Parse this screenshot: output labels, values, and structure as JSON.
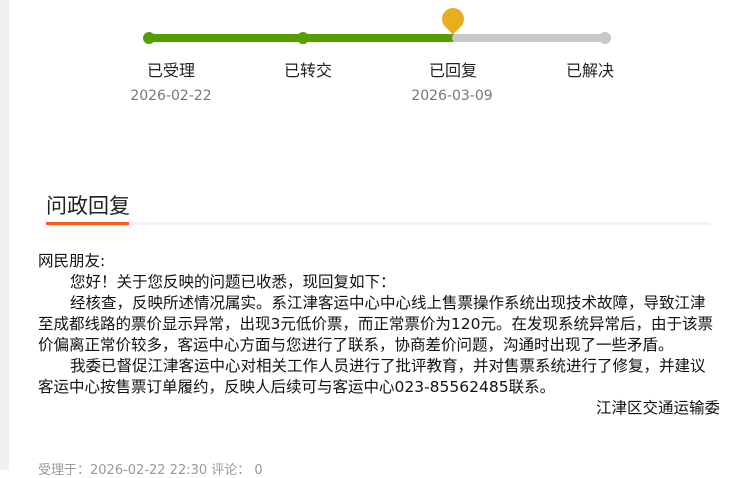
{
  "steps": [
    {
      "label": "已受理",
      "date": "2026-02-22"
    },
    {
      "label": "已转交",
      "date": ""
    },
    {
      "label": "已回复",
      "date": "2026-03-09"
    },
    {
      "label": "已解决",
      "date": ""
    }
  ],
  "colors": {
    "done": "#559e00",
    "pending": "#c8c8c8",
    "current": "#e8ae1c",
    "accent": "#ff5a1f"
  },
  "section_title": "问政回复",
  "reply": {
    "greeting": "网民朋友:",
    "p1": "您好！关于您反映的问题已收悉，现回复如下：",
    "p2": "经核查，反映所述情况属实。系江津客运中心中心线上售票操作系统出现技术故障，导致江津至成都线路的票价显示异常，出现3元低价票，而正常票价为120元。在发现系统异常后，由于该票价偏离正常价较多，客运中心方面与您进行了联系，协商差价问题，沟通时出现了一些矛盾。",
    "p3": "我委已督促江津客运中心对相关工作人员进行了批评教育，并对售票系统进行了修复，并建议客运中心按售票订单履约，反映人后续可与客运中心023-85562485联系。",
    "signature": "江津区交通运输委"
  },
  "meta": "受理于：2026-02-22 22:30 评论： 0"
}
